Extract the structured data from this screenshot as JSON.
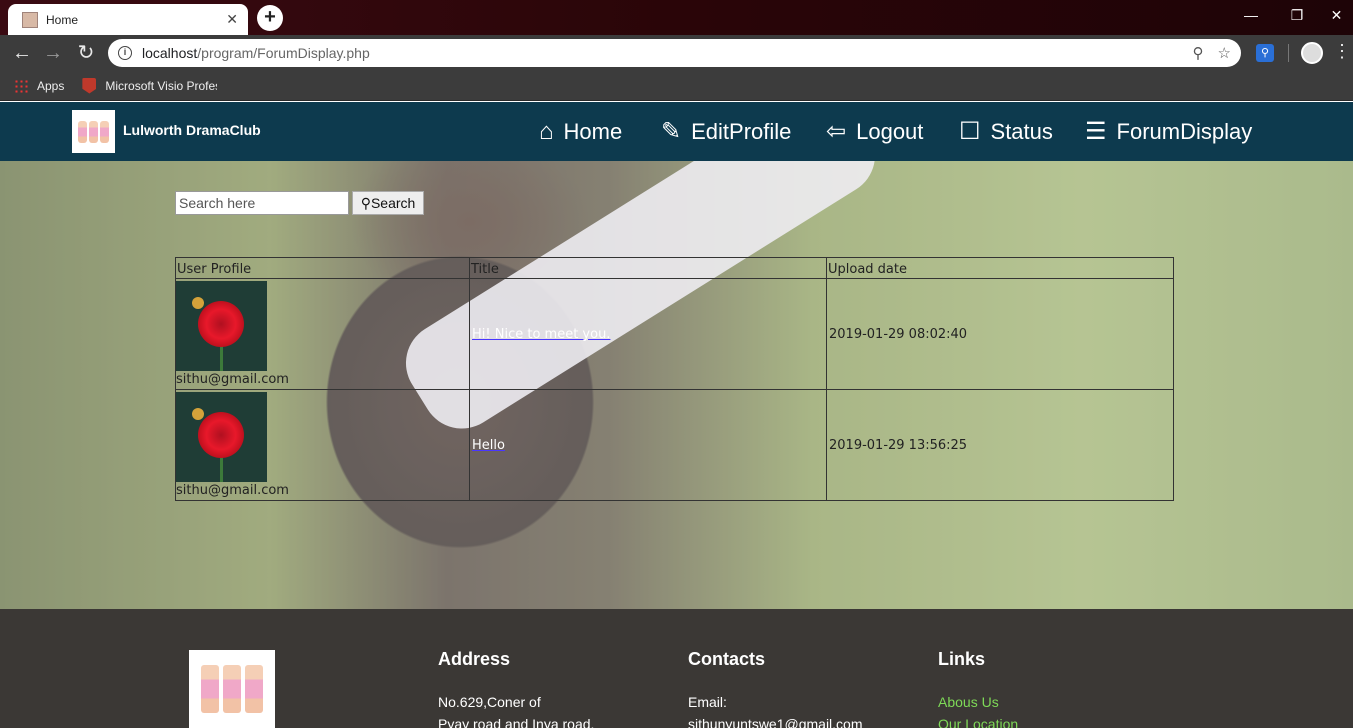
{
  "browser": {
    "tab_title": "Home",
    "tab_close": "✕",
    "new_tab": "+",
    "url_host": "localhost",
    "url_path": "/program/ForumDisplay.php",
    "bookmarks": [
      "Apps",
      "Microsoft Visio Professi"
    ]
  },
  "site": {
    "brand": "Lulworth DramaClub",
    "nav": [
      {
        "label": "Home",
        "icon": "home-icon"
      },
      {
        "label": "EditProfile",
        "icon": "pencil-icon"
      },
      {
        "label": "Logout",
        "icon": "logout-icon"
      },
      {
        "label": "Status",
        "icon": "chat-icon"
      },
      {
        "label": "ForumDisplay",
        "icon": "menu-icon"
      }
    ]
  },
  "search": {
    "placeholder": "Search here",
    "button_label": "Search"
  },
  "forum_table": {
    "headers": [
      "User Profile",
      "Title",
      "Upload date"
    ],
    "rows": [
      {
        "email": "sithu@gmail.com",
        "title": "Hi! Nice to meet you.",
        "date": "2019-01-29 08:02:40"
      },
      {
        "email": "sithu@gmail.com",
        "title": "Hello",
        "date": "2019-01-29 13:56:25"
      }
    ]
  },
  "footer": {
    "address_heading": "Address",
    "address_lines": [
      "No.629,Coner of",
      "Pyay road and Inya road,"
    ],
    "contacts_heading": "Contacts",
    "contacts_lines": [
      "Email:",
      "sithunyuntswe1@gmail.com"
    ],
    "links_heading": "Links",
    "links": [
      "Abous Us",
      "Our Location"
    ]
  },
  "colors": {
    "header_bg": "#0d3a4e",
    "footer_bg": "#3b3835",
    "link_green": "#7ed957"
  }
}
